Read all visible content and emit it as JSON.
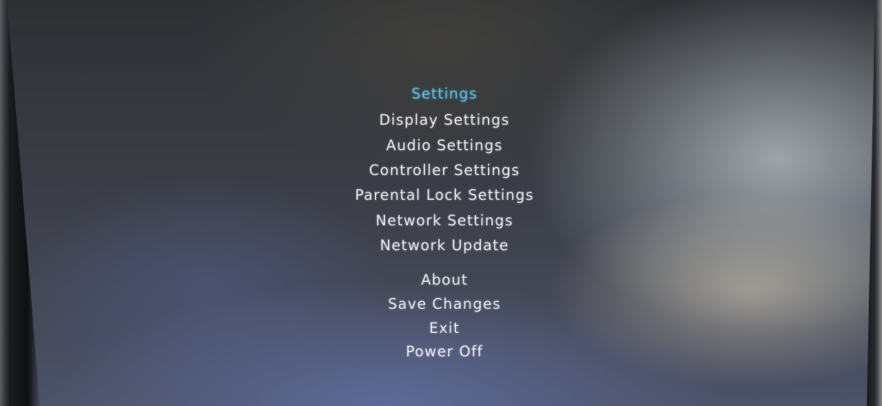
{
  "menu": {
    "title": "Settings",
    "items": [
      "Display Settings",
      "Audio Settings",
      "Controller Settings",
      "Parental Lock Settings",
      "Network Settings",
      "Network Update",
      "About",
      "Save Changes",
      "Exit",
      "Power Off"
    ]
  },
  "colors": {
    "selected_text": "#5cc9ee",
    "menu_text": "#eef0f4"
  }
}
